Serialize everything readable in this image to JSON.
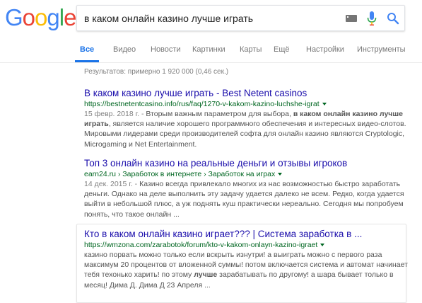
{
  "logo": {
    "letters": [
      "G",
      "o",
      "o",
      "g",
      "l",
      "e"
    ],
    "colors": [
      "#4285F4",
      "#EA4335",
      "#FBBC05",
      "#4285F4",
      "#34A853",
      "#EA4335"
    ]
  },
  "search": {
    "query": "в каком онлайн казино лучше играть"
  },
  "tabs": [
    {
      "label": "Все",
      "active": true
    },
    {
      "label": "Видео"
    },
    {
      "label": "Новости"
    },
    {
      "label": "Картинки"
    },
    {
      "label": "Карты"
    },
    {
      "label": "Ещё"
    },
    {
      "label": "Настройки"
    },
    {
      "label": "Инструменты"
    }
  ],
  "stats": "Результатов: примерно 1 920 000 (0,46 сек.)",
  "results": [
    {
      "title": "В каком казино лучше играть - Best Netent casinos",
      "url": "https://bestnetentcasino.info/rus/faq/1270-v-kakom-kazino-luchshe-igrat",
      "date": "15 февр. 2018 г. - ",
      "snippet_a": "Вторым важным параметром для выбора, ",
      "snippet_bold": "в каком онлайн казино лучше играть",
      "snippet_b": ", является наличие хорошего программного обеспечения и интересных видео-слотов. Мировыми лидерами среди производителей софта для онлайн казино являются Cryptologic, Microgaming и Net Entertainment."
    },
    {
      "title": "Топ 3 онлайн казино на реальные деньги и отзывы игроков",
      "url": "earn24.ru › Заработок в интернете › Заработок на играх",
      "date": "14 дек. 2015 г. - ",
      "snippet": "Казино всегда привлекало многих из нас возможностью быстро заработать деньги. Однако на деле выполнить эту задачу удается далеко не всем. Редко, когда удается выйти в небольшой плюс, а уж поднять куш практически нереально. Сегодня мы попробуем понять, что такое онлайн ..."
    },
    {
      "title": "Кто в каком онлайн казино играет??? | Система заработка в ...",
      "url": "https://wmzona.com/zarabotok/forum/kto-v-kakom-onlayn-kazino-igraet",
      "snippet_a": "казино порвать можно только если вскрыть изнутри! а выиграть можно с первого раза максимум 20 процентов от вложенной суммы! потом включается система и автомат начинает тебя техонько харить! по этому ",
      "snippet_bold": "лучше",
      "snippet_b": " зарабатывать по другому! а шара бывает только в месяц! Дима Д. Дима Д 23 Апреля ..."
    }
  ],
  "colors": {
    "link": "#1a0dab",
    "url": "#006621",
    "accent": "#1a73e8"
  }
}
